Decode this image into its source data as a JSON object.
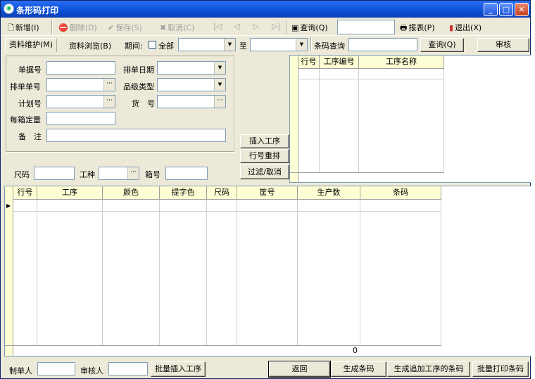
{
  "window": {
    "title": "条形码打印",
    "ctrl": {
      "min": "_",
      "max": "□",
      "close": "✕"
    }
  },
  "toolbar": {
    "new_label": "新增(I)",
    "delete_label": "删除(D)",
    "save_label": "保存(S)",
    "cancel_label": "取消(C)",
    "nav_first": "|◁",
    "nav_prev": "◁",
    "nav_next": "▷",
    "nav_last": "▷|",
    "query_label": "查询(Q)",
    "query_value": "",
    "report_label": "报表(P)",
    "exit_label": "退出(X)"
  },
  "row2": {
    "tab_maintain": "资料维护(M)",
    "tab_browse": "资料浏览(B)",
    "period_label": "期间:",
    "all_label": "全部",
    "period_from": "",
    "to_label": "至",
    "period_to": "",
    "barcode_query_label": "条码查询",
    "barcode_query_value": "",
    "query_button": "查询(Q)",
    "approve_button": "审核"
  },
  "form": {
    "doc_no_label": "单据号",
    "doc_no": "",
    "sched_date_label": "排单日期",
    "sched_date": "",
    "sched_no_label": "排单单号",
    "sched_no": "",
    "grade_label": "品级类型",
    "grade": "",
    "plan_no_label": "计划号",
    "plan_no": "",
    "item_no_label": "货　号",
    "item_no": "",
    "box_qty_label": "每箱定量",
    "box_qty": "",
    "remark_label": "备　注",
    "remark": "",
    "size_label": "尺码",
    "size": "",
    "work_type_label": "工种",
    "work_type": "",
    "box_no_label": "箱号",
    "box_no": ""
  },
  "actions": {
    "insert_process": "插入工序",
    "renumber": "行号重排",
    "filter_cancel": "过滤/取消"
  },
  "process_grid": {
    "headers": [
      "行号",
      "工序编号",
      "工序名称"
    ]
  },
  "main_grid": {
    "headers": [
      "行号",
      "工序",
      "颜色",
      "提字色",
      "尺码",
      "筐号",
      "生产数",
      "条码"
    ],
    "total_qty": "0"
  },
  "footer": {
    "maker_label": "制单人",
    "maker": "",
    "reviewer_label": "审核人",
    "reviewer": "",
    "batch_insert": "批量插入工序",
    "back": "返回",
    "gen_barcode": "生成条码",
    "gen_add_barcode": "生成追加工序的条码",
    "batch_print": "批量打印条码"
  },
  "colors": {
    "titlebar": "#0a4fd6",
    "face": "#ece9d8",
    "grid_header": "#fefed4"
  }
}
